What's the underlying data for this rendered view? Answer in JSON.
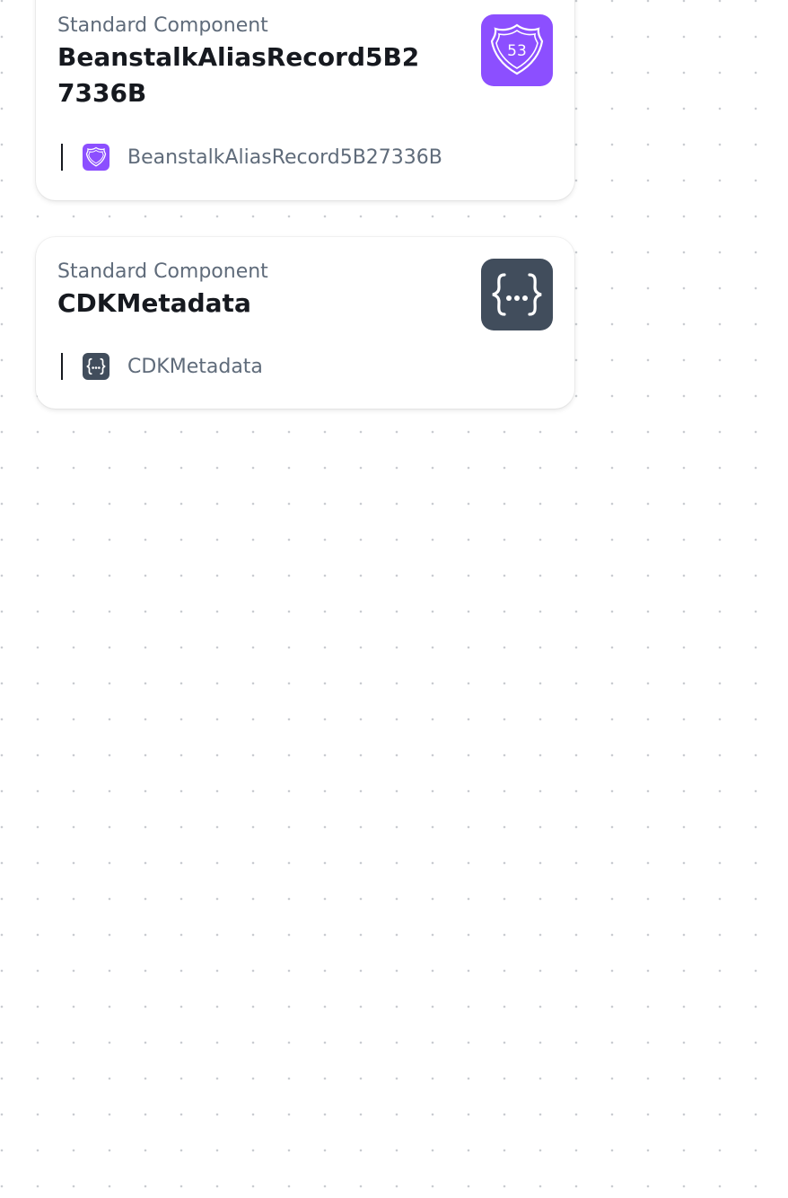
{
  "components": [
    {
      "kind": "Standard Component",
      "title": "BeanstalkAliasRecord5B27336B",
      "icon": "route53-icon",
      "icon_badge": "53",
      "icon_color": "#8c4fff",
      "resource_name": "BeanstalkAliasRecord5B27336B"
    },
    {
      "kind": "Standard Component",
      "title": "CDKMetadata",
      "icon": "cdk-metadata-icon",
      "icon_color": "#414d5c",
      "resource_name": "CDKMetadata"
    }
  ]
}
